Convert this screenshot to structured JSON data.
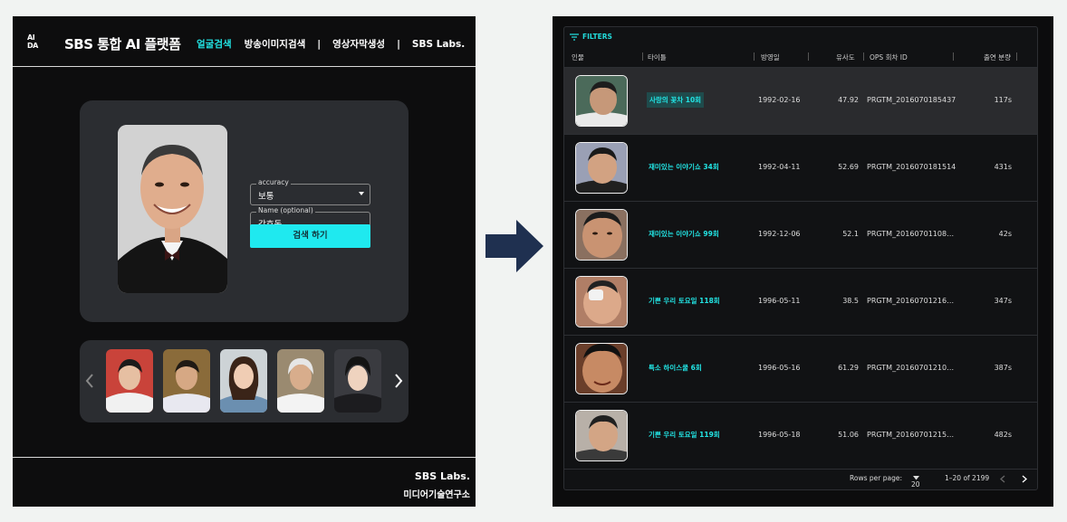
{
  "left": {
    "logo_text_1": "AI",
    "logo_text_2": "DA",
    "brand": "SBS 통합 AI 플랫폼",
    "nav": [
      "얼굴검색",
      "방송이미지검색",
      "영상자막생성",
      "SBS Labs."
    ],
    "nav_sep": "|",
    "accuracy_label": "accuracy",
    "accuracy_value": "보통",
    "name_label": "Name (optional)",
    "name_value": "강호동",
    "search_button": "검색 하기",
    "footer_line1": "SBS Labs.",
    "footer_line2": "미디어기술연구소",
    "colors": {
      "accent": "#1fe9ef",
      "card": "#2b2d31",
      "background": "#0d0d0e"
    }
  },
  "right": {
    "filters_label": "FILTERS",
    "columns": [
      "인물",
      "타이틀",
      "방영일",
      "유사도",
      "OPS 회차 ID",
      "출연 분량"
    ],
    "rows": [
      {
        "title": "사랑의 꽃차 10회",
        "date": "1992-02-16",
        "similarity": "47.92",
        "ops_id": "PRGTM_2016070185437",
        "duration": "117s"
      },
      {
        "title": "재미있는 이야기쇼 34회",
        "date": "1992-04-11",
        "similarity": "52.69",
        "ops_id": "PRGTM_2016070181514",
        "duration": "431s"
      },
      {
        "title": "재미있는 이야기쇼 99회",
        "date": "1992-12-06",
        "similarity": "52.1",
        "ops_id": "PRGTM_20160701108…",
        "duration": "42s"
      },
      {
        "title": "기쁜 우리 토요일 118회",
        "date": "1996-05-11",
        "similarity": "38.5",
        "ops_id": "PRGTM_20160701216…",
        "duration": "347s"
      },
      {
        "title": "특소 하이스쿨 6회",
        "date": "1996-05-16",
        "similarity": "61.29",
        "ops_id": "PRGTM_20160701210…",
        "duration": "387s"
      },
      {
        "title": "기쁜 우리 토요일 119회",
        "date": "1996-05-18",
        "similarity": "51.06",
        "ops_id": "PRGTM_20160701215…",
        "duration": "482s"
      }
    ],
    "rows_per_page_label": "Rows per page:",
    "rows_per_page_value": "20",
    "range": "1–20 of 2199"
  }
}
